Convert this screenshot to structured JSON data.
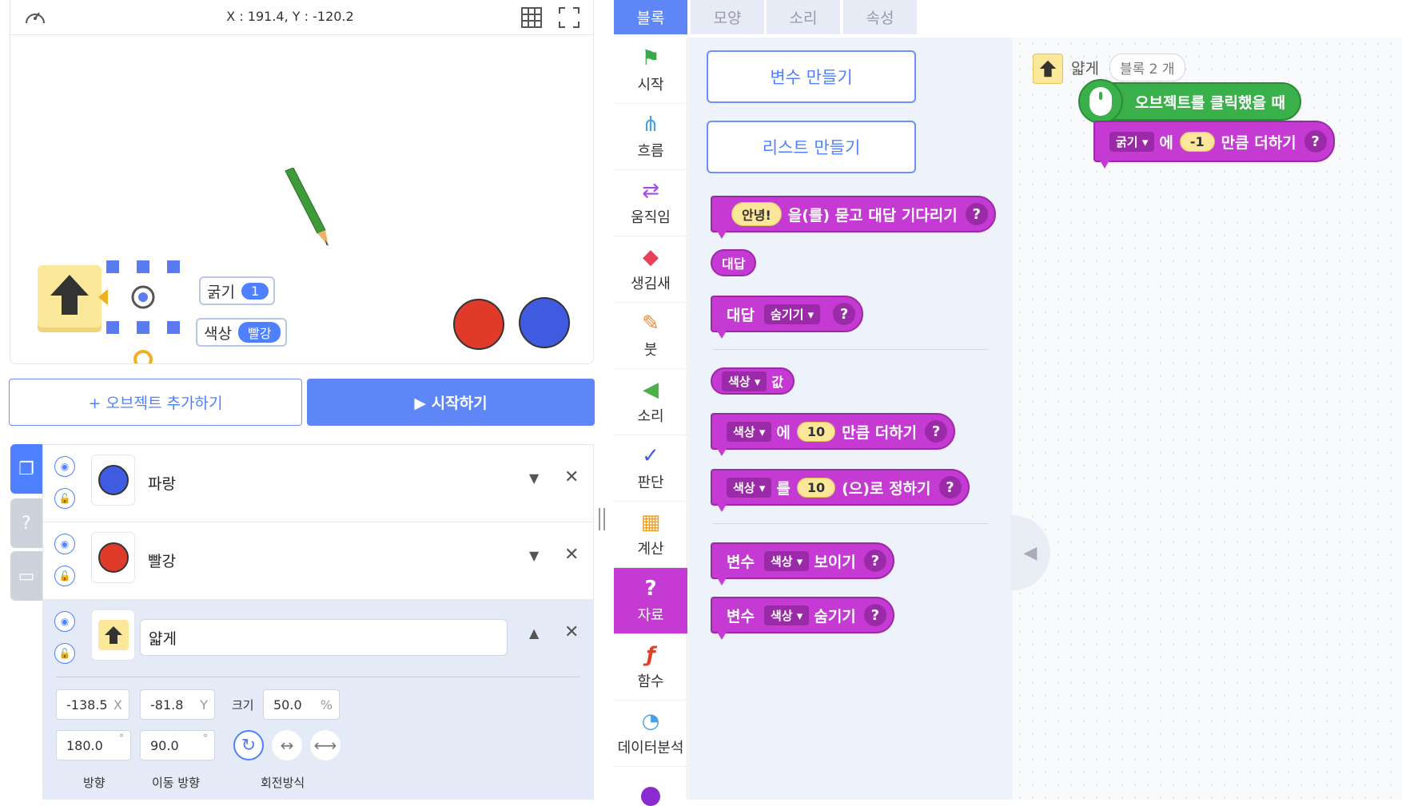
{
  "stage": {
    "coords": "X : 191.4, Y : -120.2",
    "var_thickness_label": "굵기",
    "var_thickness_value": "1",
    "var_color_label": "색상",
    "var_color_value": "빨강"
  },
  "buttons": {
    "add_object": "+ 오브젝트 추가하기",
    "start": "▶ 시작하기"
  },
  "objects": [
    {
      "name": "파랑",
      "color": "#3f5be0"
    },
    {
      "name": "빨강",
      "color": "#e03a2a"
    },
    {
      "name": "얇게",
      "color": "#fbe89a"
    }
  ],
  "props": {
    "x": "-138.5",
    "x_unit": "X",
    "y": "-81.8",
    "y_unit": "Y",
    "size_label": "크기",
    "size": "50.0",
    "size_unit": "%",
    "direction": "180.0",
    "move_direction": "90.0",
    "degree": "°",
    "direction_label": "방향",
    "move_direction_label": "이동 방향",
    "rotation_label": "회전방식"
  },
  "tabs": [
    "블록",
    "모양",
    "소리",
    "속성"
  ],
  "categories": [
    {
      "label": "시작",
      "icon": "flag-icon",
      "glyph": "⚑",
      "color": "#3aa84a"
    },
    {
      "label": "흐름",
      "icon": "flow-icon",
      "glyph": "⋔",
      "color": "#4aa0e8"
    },
    {
      "label": "움직임",
      "icon": "move-icon",
      "glyph": "⇄",
      "color": "#a04ae8"
    },
    {
      "label": "생김새",
      "icon": "looks-icon",
      "glyph": "◆",
      "color": "#e8415a"
    },
    {
      "label": "붓",
      "icon": "brush-icon",
      "glyph": "✎",
      "color": "#f08a2a"
    },
    {
      "label": "소리",
      "icon": "sound-icon",
      "glyph": "◀",
      "color": "#4ab04a"
    },
    {
      "label": "판단",
      "icon": "judge-icon",
      "glyph": "✓",
      "color": "#3f5be0"
    },
    {
      "label": "계산",
      "icon": "calc-icon",
      "glyph": "▦",
      "color": "#f0a020"
    },
    {
      "label": "자료",
      "icon": "data-icon",
      "glyph": "?",
      "color": "#ffffff"
    },
    {
      "label": "함수",
      "icon": "function-icon",
      "glyph": "ƒ",
      "color": "#e0402a"
    },
    {
      "label": "데이터분석",
      "icon": "chart-icon",
      "glyph": "◔",
      "color": "#4aa0e8"
    }
  ],
  "palette": {
    "make_variable": "변수 만들기",
    "make_list": "리스트 만들기",
    "ask_hello": "안녕!",
    "ask_text": "을(를) 묻고 대답 기다리기",
    "answer": "대답",
    "answer_label": "대답",
    "answer_hide": "숨기기",
    "var_color": "색상",
    "value": "값",
    "add_to": "에",
    "add_amount": "10",
    "add_text": "만큼 더하기",
    "set_to": "를",
    "set_amount": "10",
    "set_text": "(으)로 정하기",
    "show_prefix": "변수",
    "show_text": "보이기",
    "hide_prefix": "변수",
    "hide_text": "숨기기",
    "help": "?"
  },
  "workspace": {
    "object_name": "얇게",
    "block_count": "블록 2 개",
    "event_block": "오브젝트를 클릭했을 때",
    "var_name": "굵기",
    "add_to": "에",
    "amount": "-1",
    "add_text": "만큼 더하기",
    "help": "?"
  }
}
